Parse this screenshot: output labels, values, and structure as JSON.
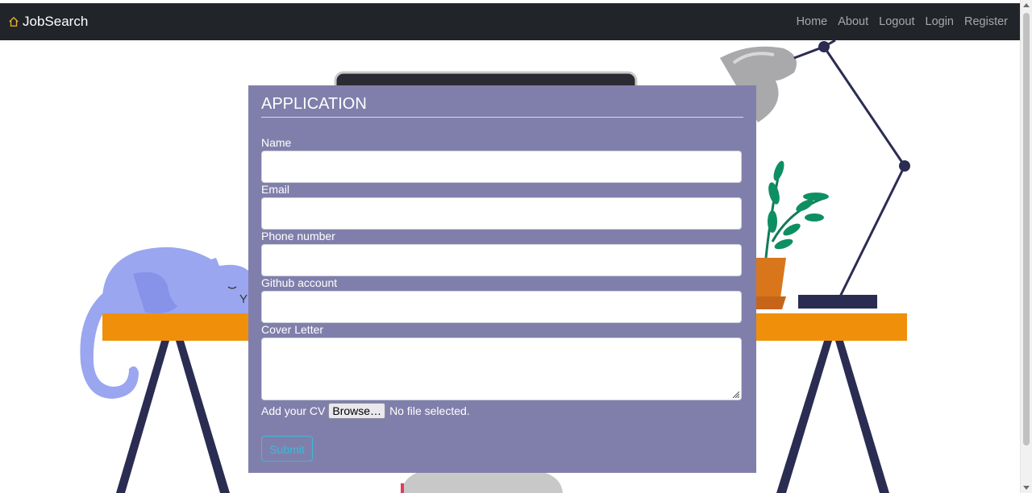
{
  "brand": {
    "name": "JobSearch",
    "icon": "house-icon"
  },
  "nav": {
    "links": [
      "Home",
      "About",
      "Logout",
      "Login",
      "Register"
    ]
  },
  "form": {
    "title": "APPLICATION",
    "fields": {
      "name": {
        "label": "Name",
        "value": ""
      },
      "email": {
        "label": "Email",
        "value": ""
      },
      "phone": {
        "label": "Phone number",
        "value": ""
      },
      "github": {
        "label": "Github account",
        "value": ""
      },
      "cover": {
        "label": "Cover Letter",
        "value": ""
      }
    },
    "cv": {
      "label": "Add your CV",
      "button": "Browse…",
      "status": "No file selected."
    },
    "submit": "Submit"
  },
  "colors": {
    "navbar": "#212529",
    "card": "#807fac",
    "accent": "#3fb8d4",
    "brand_icon": "#f0b429"
  }
}
